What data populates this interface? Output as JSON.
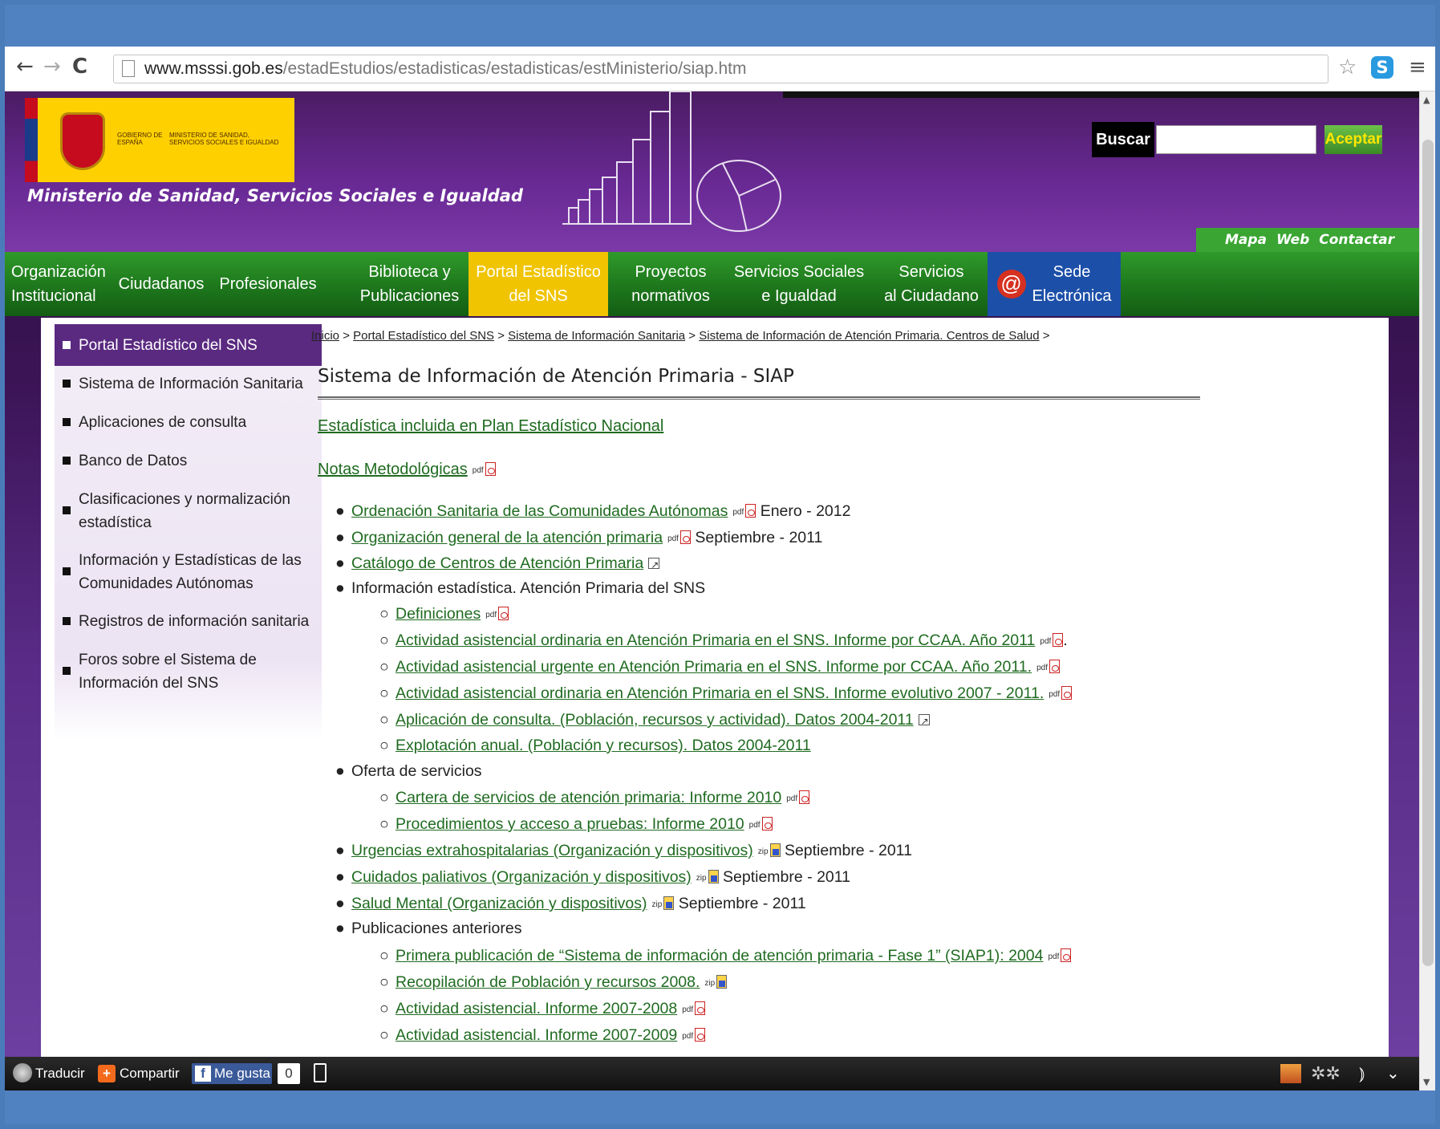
{
  "browser": {
    "url_host": "www.msssi.gob.es",
    "url_path": "/estadEstudios/estadisticas/estadisticas/estMinisterio/siap.htm"
  },
  "header": {
    "logo_gobierno": "GOBIERNO DE ESPAÑA",
    "logo_ministerio": "MINISTERIO DE SANIDAD, SERVICIOS SOCIALES E IGUALDAD",
    "ministry_name": "Ministerio de Sanidad, Servicios Sociales e Igualdad",
    "search_label": "Buscar",
    "search_button": "Aceptar",
    "map_links": "Mapa Web Contactar"
  },
  "nav": {
    "items": [
      {
        "line1": "Organización",
        "line2": "Institucional"
      },
      {
        "line1": "Ciudadanos",
        "line2": ""
      },
      {
        "line1": "Profesionales",
        "line2": ""
      },
      {
        "line1": "Biblioteca y",
        "line2": "Publicaciones"
      },
      {
        "line1": "Portal Estadístico",
        "line2": "del SNS"
      },
      {
        "line1": "Proyectos",
        "line2": "normativos"
      },
      {
        "line1": "Servicios Sociales",
        "line2": "e Igualdad"
      },
      {
        "line1": "Servicios",
        "line2": "al Ciudadano"
      },
      {
        "line1": "Sede",
        "line2": "Electrónica"
      }
    ]
  },
  "sidebar": {
    "items": [
      {
        "label": "Portal Estadístico del SNS"
      },
      {
        "label": "Sistema de Información Sanitaria"
      },
      {
        "label": "Aplicaciones de consulta"
      },
      {
        "label": "Banco de Datos"
      },
      {
        "label1": "Clasificaciones y normalización",
        "label2": "estadística"
      },
      {
        "label1": "Información y Estadísticas de las",
        "label2": "Comunidades Autónomas"
      },
      {
        "label": "Registros de información sanitaria"
      },
      {
        "label1": "Foros sobre el Sistema de",
        "label2": "Información del SNS"
      }
    ]
  },
  "breadcrumb": {
    "items": [
      "Inicio",
      "Portal Estadístico del SNS",
      "Sistema de Información Sanitaria",
      "Sistema de Información de Atención Primaria. Centros de Salud"
    ],
    "sep": " > "
  },
  "page": {
    "title": "Sistema de Información de Atención Primaria - SIAP",
    "stat_link": "Estadística incluida en Plan Estadístico Nacional",
    "notas": "Notas Metodológicas",
    "pdf_tag": "pdf",
    "zip_tag": "zip"
  },
  "list": {
    "i1": {
      "link": "Ordenación Sanitaria de las Comunidades Autónomas",
      "suffix": "Enero - 2012"
    },
    "i2": {
      "link": "Organización general de la atención primaria",
      "suffix": "Septiembre - 2011"
    },
    "i3": {
      "link": "Catálogo de Centros de Atención Primaria"
    },
    "i4": {
      "text": "Información estadística. Atención Primaria del SNS"
    },
    "i4a": {
      "link": "Definiciones"
    },
    "i4b": {
      "link": "Actividad asistencial ordinaria en Atención Primaria en el SNS. Informe por CCAA. Año 2011",
      "suffix": "."
    },
    "i4c": {
      "link": "Actividad asistencial urgente en Atención Primaria en el SNS. Informe por CCAA. Año 2011."
    },
    "i4d": {
      "link": "Actividad asistencial ordinaria en Atención Primaria en el SNS. Informe evolutivo 2007 - 2011."
    },
    "i4e": {
      "link": "Aplicación de consulta. (Población, recursos y actividad). Datos 2004-2011"
    },
    "i4f": {
      "link": "Explotación anual. (Población y recursos). Datos 2004-2011"
    },
    "i5": {
      "text": "Oferta de servicios"
    },
    "i5a": {
      "link": "Cartera de servicios de atención primaria: Informe 2010"
    },
    "i5b": {
      "link": "Procedimientos y acceso a pruebas: Informe 2010"
    },
    "i6": {
      "link": "Urgencias extrahospitalarias (Organización y dispositivos)",
      "suffix": "Septiembre - 2011"
    },
    "i7": {
      "link": "Cuidados paliativos (Organización y dispositivos)",
      "suffix": "Septiembre - 2011"
    },
    "i8": {
      "link": "Salud Mental (Organización y dispositivos)",
      "suffix": "Septiembre - 2011"
    },
    "i9": {
      "text": "Publicaciones anteriores"
    },
    "i9a": {
      "link": "Primera publicación de “Sistema de información de atención primaria - Fase 1” (SIAP1): 2004"
    },
    "i9b": {
      "link": "Recopilación de Población y recursos 2008."
    },
    "i9c": {
      "link": "Actividad asistencial. Informe 2007-2008"
    },
    "i9d": {
      "link": "Actividad asistencial. Informe 2007-2009"
    }
  },
  "bottombar": {
    "translate": "Traducir",
    "share": "Compartir",
    "like": "Me gusta",
    "like_count": "0"
  }
}
